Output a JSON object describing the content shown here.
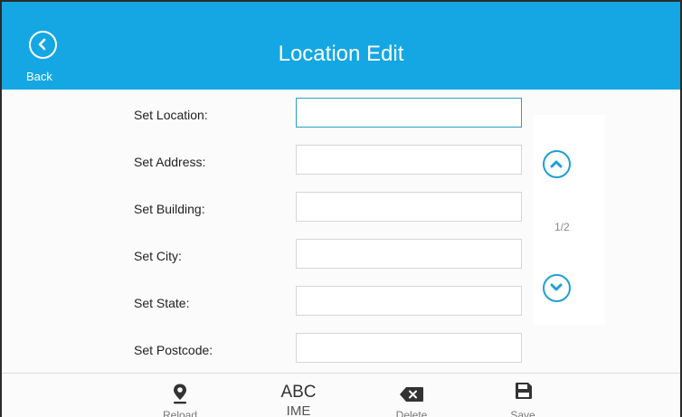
{
  "header": {
    "title": "Location Edit",
    "back_label": "Back",
    "color": "#14a7e3"
  },
  "form": {
    "fields": [
      {
        "label": "Set Location:",
        "value": "",
        "active": true
      },
      {
        "label": "Set Address:",
        "value": ""
      },
      {
        "label": "Set Building:",
        "value": ""
      },
      {
        "label": "Set City:",
        "value": ""
      },
      {
        "label": "Set State:",
        "value": ""
      },
      {
        "label": "Set Postcode:",
        "value": ""
      }
    ]
  },
  "pager": {
    "indicator": "1/2",
    "up_icon": "chevron-up-icon",
    "down_icon": "chevron-down-icon"
  },
  "softkeys": {
    "reload_label": "Reload",
    "reload_icon": "location-pin-icon",
    "ime_top": "ABC",
    "ime_label": "IME",
    "delete_label": "Delete",
    "delete_icon": "backspace-icon",
    "save_label": "Save",
    "save_icon": "floppy-disk-icon"
  }
}
